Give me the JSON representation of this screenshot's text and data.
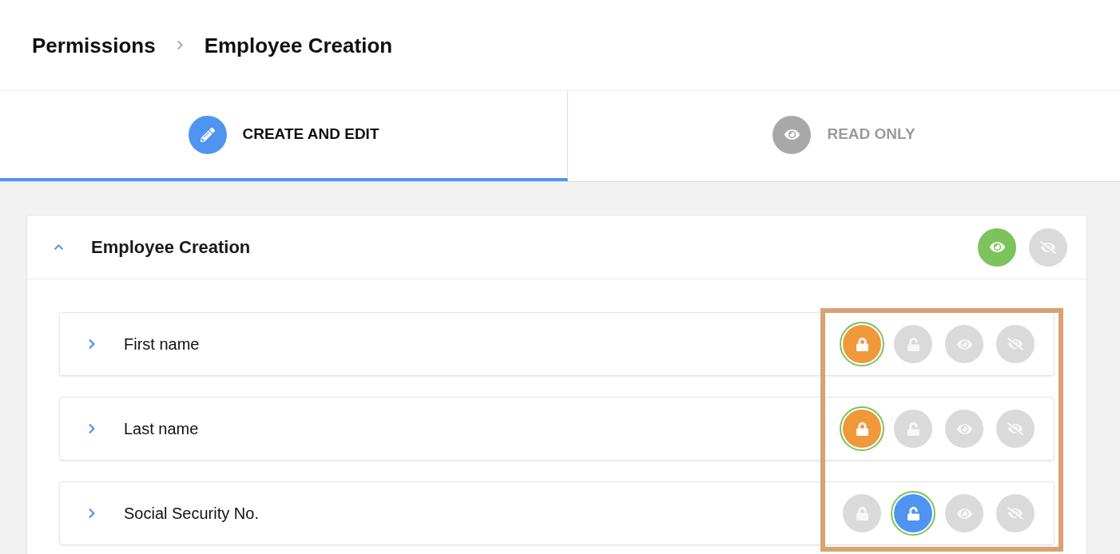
{
  "breadcrumb": [
    "Permissions",
    "Employee Creation"
  ],
  "tabs": [
    {
      "label": "CREATE AND EDIT",
      "kind": "edit",
      "selected": true
    },
    {
      "label": "READ ONLY",
      "kind": "view",
      "selected": false
    }
  ],
  "section": {
    "title": "Employee Creation",
    "expanded": true,
    "visibility": [
      {
        "kind": "visible",
        "selected": true
      },
      {
        "kind": "hidden",
        "selected": false
      }
    ]
  },
  "fields": [
    {
      "label": "First name",
      "expanded": false,
      "permissions": [
        {
          "kind": "locked",
          "selected": true
        },
        {
          "kind": "unlocked",
          "selected": false
        },
        {
          "kind": "visible",
          "selected": false
        },
        {
          "kind": "hidden",
          "selected": false
        }
      ]
    },
    {
      "label": "Last name",
      "expanded": false,
      "permissions": [
        {
          "kind": "locked",
          "selected": true
        },
        {
          "kind": "unlocked",
          "selected": false
        },
        {
          "kind": "visible",
          "selected": false
        },
        {
          "kind": "hidden",
          "selected": false
        }
      ]
    },
    {
      "label": "Social Security No.",
      "expanded": false,
      "permissions": [
        {
          "kind": "locked",
          "selected": false
        },
        {
          "kind": "unlocked",
          "selected": true
        },
        {
          "kind": "visible",
          "selected": false
        },
        {
          "kind": "hidden",
          "selected": false
        }
      ]
    }
  ]
}
